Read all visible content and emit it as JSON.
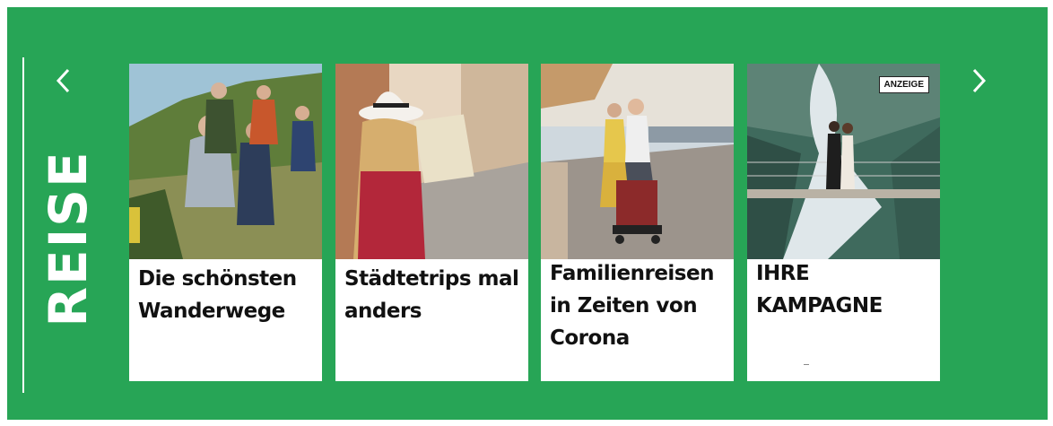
{
  "section": {
    "title": "REISE"
  },
  "nav": {
    "prev_icon": "chevron-left-icon",
    "next_icon": "chevron-right-icon"
  },
  "cards": [
    {
      "title_line1": "Die schönsten",
      "title_line2": "Wanderwege",
      "title_line3": ""
    },
    {
      "title_line1": "Städtetrips mal",
      "title_line2": "anders",
      "title_line3": ""
    },
    {
      "title_line1": "Familienreisen",
      "title_line2": "in Zeiten von",
      "title_line3": "Corona"
    },
    {
      "title_line1": "IHRE",
      "title_line2": "KAMPAGNE",
      "title_line3": "",
      "badge": "ANZEIGE"
    }
  ],
  "colors": {
    "accent": "#27a556",
    "card_bg": "#ffffff",
    "text": "#111111"
  }
}
